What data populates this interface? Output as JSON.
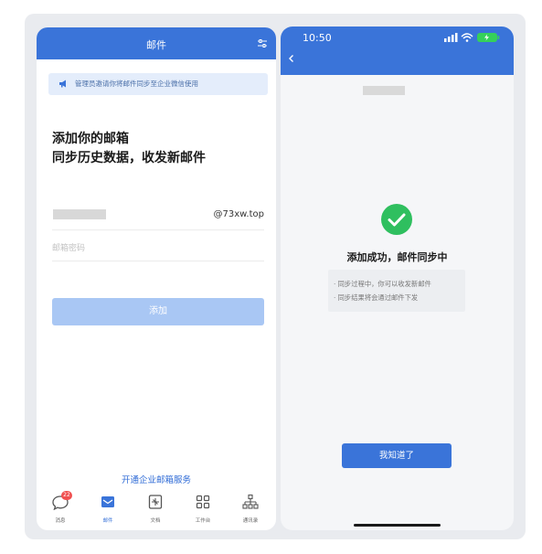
{
  "left_screen": {
    "header_title": "邮件",
    "notice_text": "管理员邀请你将邮件同步至企业微信使用",
    "heading_line1": "添加你的邮箱",
    "heading_line2": "同步历史数据，收发新邮件",
    "email_domain": "@73xw.top",
    "password_placeholder": "邮箱密码",
    "add_button_label": "添加",
    "open_service_link": "开通企业邮箱服务",
    "tabs": [
      {
        "label": "消息",
        "icon": "chat-icon",
        "badge": "22"
      },
      {
        "label": "邮件",
        "icon": "mail-icon",
        "active": true
      },
      {
        "label": "文档",
        "icon": "document-icon"
      },
      {
        "label": "工作台",
        "icon": "grid-icon"
      },
      {
        "label": "通讯录",
        "icon": "org-chart-icon"
      }
    ]
  },
  "right_screen": {
    "status_time": "10:50",
    "success_title": "添加成功，邮件同步中",
    "info_lines": [
      "· 同步过程中，你可以收发新邮件",
      "· 同步结果将会通过邮件下发"
    ],
    "ok_button_label": "我知道了"
  },
  "colors": {
    "accent": "#3a74d9",
    "disabled_button": "#a9c7f4",
    "success": "#2fbf5f",
    "badge": "#f05050"
  }
}
